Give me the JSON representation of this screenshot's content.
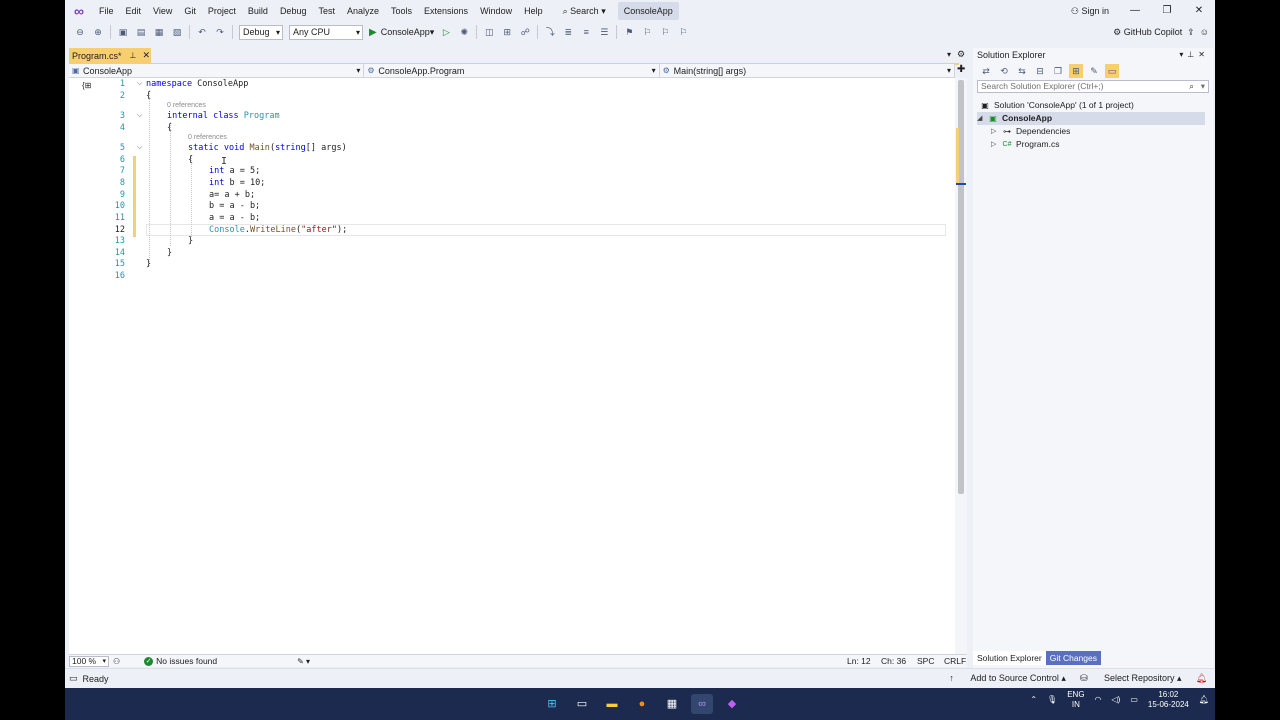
{
  "menubar": {
    "items": [
      "File",
      "Edit",
      "View",
      "Git",
      "Project",
      "Build",
      "Debug",
      "Test",
      "Analyze",
      "Tools",
      "Extensions",
      "Window",
      "Help"
    ],
    "search_label": "Search",
    "solution_name": "ConsoleApp",
    "sign_in": "Sign in"
  },
  "toolbar": {
    "config": "Debug",
    "platform": "Any CPU",
    "start_target": "ConsoleApp",
    "copilot": "GitHub Copilot"
  },
  "tab": {
    "label": "Program.cs*"
  },
  "navbar": {
    "project": "ConsoleApp",
    "class": "ConsoleApp.Program",
    "member": "Main(string[] args)"
  },
  "editor": {
    "line_numbers": [
      "1",
      "2",
      "3",
      "4",
      "5",
      "6",
      "7",
      "8",
      "9",
      "10",
      "11",
      "12",
      "13",
      "14",
      "15",
      "16"
    ],
    "refs_class": "0 references",
    "refs_method": "0 references",
    "code": {
      "l1_kw": "namespace",
      "l1_name": " ConsoleApp",
      "l2": "{",
      "l3_kw1": "internal",
      "l3_kw2": "class",
      "l3_type": "Program",
      "l4": "{",
      "l5_kw1": "static",
      "l5_kw2": "void",
      "l5_method": "Main",
      "l5_kw3": "string",
      "l5_rest": "[] args)",
      "l6": "{",
      "l7_kw": "int",
      "l7_rest": " a = 5;",
      "l8_kw": "int",
      "l8_rest": " b = 10;",
      "l9": "a= a + b;",
      "l10": "b = a - b;",
      "l11": "a = a - b;",
      "l12_type": "Console",
      "l12_dot": ".",
      "l12_method": "WriteLine",
      "l12_open": "(",
      "l12_str": "\"after",
      "l12_close": "\");",
      "l13": "}",
      "l14": "}",
      "l15": "}"
    }
  },
  "editor_status": {
    "zoom": "100 %",
    "issues": "No issues found",
    "line": "Ln: 12",
    "col": "Ch: 36",
    "spc": "SPC",
    "eol": "CRLF"
  },
  "solution_explorer": {
    "title": "Solution Explorer",
    "search_placeholder": "Search Solution Explorer (Ctrl+;)",
    "solution": "Solution 'ConsoleApp' (1 of 1 project)",
    "project": "ConsoleApp",
    "dependencies": "Dependencies",
    "file": "Program.cs",
    "tab_active": "Solution Explorer",
    "tab_other": "Git Changes"
  },
  "statusbar": {
    "ready": "Ready",
    "add_source": "Add to Source Control",
    "select_repo": "Select Repository"
  },
  "taskbar": {
    "lang1": "ENG",
    "lang2": "IN",
    "time": "16:02",
    "date": "15-06-2024"
  },
  "colors": {
    "keyword": "#0000ff",
    "type": "#2b91af",
    "string": "#a31515",
    "tab_active": "#f7cf70"
  }
}
